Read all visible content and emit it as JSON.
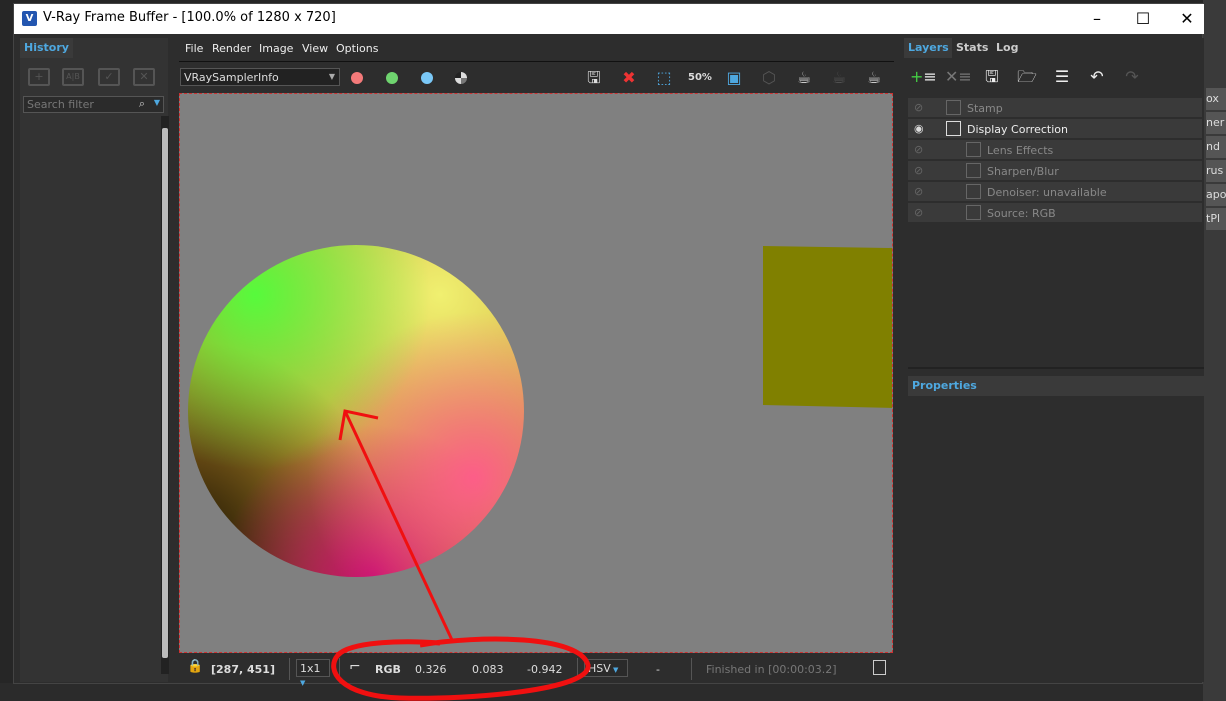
{
  "window": {
    "title": "V-Ray Frame Buffer - [100.0% of 1280 x 720]",
    "logo": "V",
    "minimize": "–",
    "maximize": "☐",
    "close": "✕"
  },
  "history": {
    "tab": "History",
    "icons": [
      "add-icon",
      "ab-compare-icon",
      "check-icon",
      "delete-icon"
    ],
    "search_placeholder": "Search filter"
  },
  "menu": [
    "File",
    "Render",
    "Image",
    "View",
    "Options"
  ],
  "toolbar": {
    "channel": "VRaySamplerInfo",
    "colors": {
      "red": "#f47a7a",
      "green": "#6fd46f",
      "blue": "#7ac8f7"
    },
    "zoom_label": "50%"
  },
  "status": {
    "coords": "[287, 451]",
    "sample": "1x1",
    "mode": "RGB",
    "r": "0.326",
    "g": "0.083",
    "b": "-0.942",
    "colorspace": "HSV",
    "dash": "-",
    "finished": "Finished in [00:00:03.2]"
  },
  "right": {
    "tabs": [
      "Layers",
      "Stats",
      "Log"
    ],
    "layers": [
      {
        "label": "Stamp",
        "visible": false,
        "indent": 0
      },
      {
        "label": "Display Correction",
        "visible": true,
        "indent": 0
      },
      {
        "label": "Lens Effects",
        "visible": false,
        "indent": 1
      },
      {
        "label": "Sharpen/Blur",
        "visible": false,
        "indent": 1
      },
      {
        "label": "Denoiser: unavailable",
        "visible": false,
        "indent": 1
      },
      {
        "label": "Source: RGB",
        "visible": false,
        "indent": 1
      }
    ],
    "properties": "Properties"
  },
  "background_app": {
    "labels": [
      "ox",
      "ner",
      "nd",
      "rus",
      "apo",
      "tPl"
    ]
  }
}
